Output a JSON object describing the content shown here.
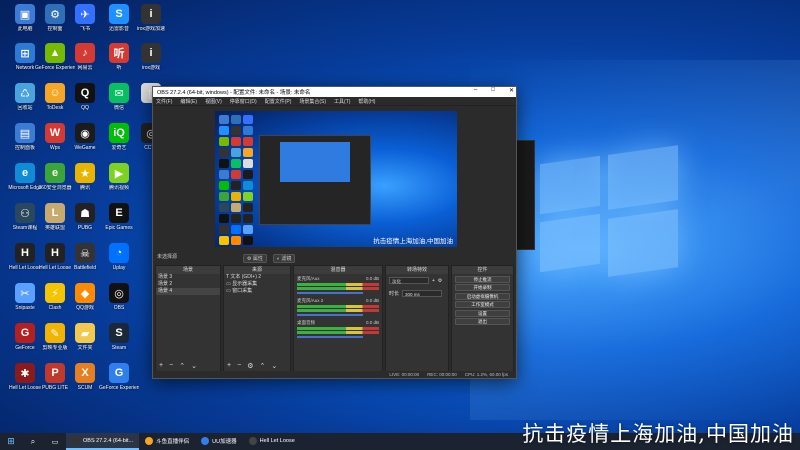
{
  "desktop_icons": [
    {
      "id": "r0c0",
      "label": "此电脑",
      "color": "#3b7bd4",
      "glyph": "▣"
    },
    {
      "id": "r0c1",
      "label": "控制面",
      "color": "#2e6fb7",
      "glyph": "⚙"
    },
    {
      "id": "r0c2",
      "label": "飞书",
      "color": "#3370ff",
      "glyph": "✈"
    },
    {
      "id": "r0c3",
      "label": "迅雷影音",
      "color": "#1e90ff",
      "glyph": "S"
    },
    {
      "id": "r0c4",
      "label": "irox游戏加速",
      "color": "#333333",
      "glyph": "i"
    },
    {
      "id": "r1c0",
      "label": "Network",
      "color": "#2c7ad6",
      "glyph": "⊞"
    },
    {
      "id": "r1c1",
      "label": "GeForce Experience",
      "color": "#76b900",
      "glyph": "▲"
    },
    {
      "id": "r1c2",
      "label": "网易云",
      "color": "#d33a31",
      "glyph": "♪"
    },
    {
      "id": "r1c3",
      "label": "听",
      "color": "#d33a31",
      "glyph": "听"
    },
    {
      "id": "r1c4",
      "label": "irox游戏",
      "color": "#333333",
      "glyph": "i"
    },
    {
      "id": "r2c0",
      "label": "回收站",
      "color": "#4aa3df",
      "glyph": "♺"
    },
    {
      "id": "r2c1",
      "label": "ToDesk",
      "color": "#f5a623",
      "glyph": "☺"
    },
    {
      "id": "r2c2",
      "label": "QQ",
      "color": "#111111",
      "glyph": "Q"
    },
    {
      "id": "r2c3",
      "label": "微信",
      "color": "#07c160",
      "glyph": "✉"
    },
    {
      "id": "r2c4",
      "label": "",
      "color": "#dddddd",
      "glyph": "▯"
    },
    {
      "id": "r3c0",
      "label": "控制面板",
      "color": "#3b7bd4",
      "glyph": "▤"
    },
    {
      "id": "r3c1",
      "label": "Wps",
      "color": "#d33a31",
      "glyph": "W"
    },
    {
      "id": "r3c2",
      "label": "WeGame",
      "color": "#1b1b1b",
      "glyph": "◉"
    },
    {
      "id": "r3c3",
      "label": "爱奇艺",
      "color": "#00be06",
      "glyph": "iQ"
    },
    {
      "id": "r3c4",
      "label": "CCTV",
      "color": "#222222",
      "glyph": "◎"
    },
    {
      "id": "r4c0",
      "label": "Microsoft Edge",
      "color": "#0f8bd8",
      "glyph": "e"
    },
    {
      "id": "r4c1",
      "label": "360安全浏览器",
      "color": "#3ca53a",
      "glyph": "e"
    },
    {
      "id": "r4c2",
      "label": "腾讯",
      "color": "#e8b400",
      "glyph": "★"
    },
    {
      "id": "r4c3",
      "label": "腾讯视频",
      "color": "#7ed321",
      "glyph": "▶"
    },
    {
      "id": "r5c0",
      "label": "Steam课程",
      "color": "#2a475e",
      "glyph": "⚇"
    },
    {
      "id": "r5c1",
      "label": "英雄联盟",
      "color": "#c8aa6e",
      "glyph": "L"
    },
    {
      "id": "r5c2",
      "label": "PUBG",
      "color": "#222222",
      "glyph": "☗"
    },
    {
      "id": "r5c3",
      "label": "Epic Games",
      "color": "#111111",
      "glyph": "E"
    },
    {
      "id": "r6c0",
      "label": "Hell Let Loose",
      "color": "#222222",
      "glyph": "H"
    },
    {
      "id": "r6c1",
      "label": "Hell Let Loose",
      "color": "#222222",
      "glyph": "H"
    },
    {
      "id": "r6c2",
      "label": "Battlefield",
      "color": "#333333",
      "glyph": "☠"
    },
    {
      "id": "r6c3",
      "label": "Uplay",
      "color": "#0070ff",
      "glyph": "◔"
    },
    {
      "id": "r7c0",
      "label": "Snipaste",
      "color": "#5aa0ff",
      "glyph": "✂"
    },
    {
      "id": "r7c1",
      "label": "Clash",
      "color": "#f5c400",
      "glyph": "⚡"
    },
    {
      "id": "r7c2",
      "label": "QQ游戏",
      "color": "#ff8a00",
      "glyph": "◆"
    },
    {
      "id": "r7c3",
      "label": "OBS",
      "color": "#111111",
      "glyph": "◎"
    },
    {
      "id": "r8c0",
      "label": "GeForce",
      "color": "#b32020",
      "glyph": "G"
    },
    {
      "id": "r8c1",
      "label": "剪映专业版",
      "color": "#f2b400",
      "glyph": "✎"
    },
    {
      "id": "r8c2",
      "label": "文件夹",
      "color": "#f2c94c",
      "glyph": "▰"
    },
    {
      "id": "r8c3",
      "label": "Steam",
      "color": "#1b2838",
      "glyph": "S"
    },
    {
      "id": "r9c0",
      "label": "Hell Let Loose",
      "color": "#8b1a1a",
      "glyph": "✱"
    },
    {
      "id": "r9c1",
      "label": "PUBG LITE",
      "color": "#c0392b",
      "glyph": "P"
    },
    {
      "id": "r9c2",
      "label": "SCUM",
      "color": "#e67e22",
      "glyph": "X"
    },
    {
      "id": "r9c3",
      "label": "GeForce Experience",
      "color": "#2f80ed",
      "glyph": "G"
    }
  ],
  "obs": {
    "title": "OBS 27.2.4 (64-bit, windows) - 配置文件: 未命名 - 场景: 未命名",
    "menu": [
      "文件(F)",
      "编辑(E)",
      "视图(V)",
      "停靠窗口(D)",
      "配置文件(P)",
      "场景集合(S)",
      "工具(T)",
      "帮助(H)"
    ],
    "preview_caption": "抗击疫情上海加油,中国加油",
    "scene_label": "未选择源",
    "preview_buttons": [
      "属性",
      "滤镜"
    ],
    "scenes_header": "场景",
    "scenes": [
      "场景 3",
      "场景 2",
      "场景 4"
    ],
    "sources_header": "来源",
    "sources": [
      "文本 (GDI+) 2",
      "显示器采集",
      "窗口采集"
    ],
    "mixer_header": "混音器",
    "mixer": [
      {
        "name": "麦克风/Aux",
        "db": "0.0 dB"
      },
      {
        "name": "麦克风/Aux 2",
        "db": "0.0 dB"
      },
      {
        "name": "桌面音频",
        "db": "0.0 dB"
      }
    ],
    "transitions_header": "转场特效",
    "transition_value": "淡化",
    "duration_label": "时长",
    "duration_value": "300 ms",
    "controls_header": "控件",
    "controls": [
      "停止推流",
      "开始录制",
      "启动虚拟摄像机",
      "工作室模式",
      "设置",
      "退出"
    ],
    "status": [
      "LIVE: 00:00:00",
      "REC: 00:00:00",
      "CPU: 1.2%, 60.00 fps"
    ]
  },
  "taskbar": {
    "items": [
      {
        "label": "OBS 27.2.4 (64-bit...",
        "color": "#333333",
        "active": true
      },
      {
        "label": "斗鱼直播伴侣",
        "color": "#f5a623",
        "active": false
      },
      {
        "label": "UU加速器",
        "color": "#2f80ed",
        "active": false
      },
      {
        "label": "Hell Let Loose",
        "color": "#444444",
        "active": false
      }
    ]
  },
  "watermark": "抗击疫情上海加油,中国加油"
}
